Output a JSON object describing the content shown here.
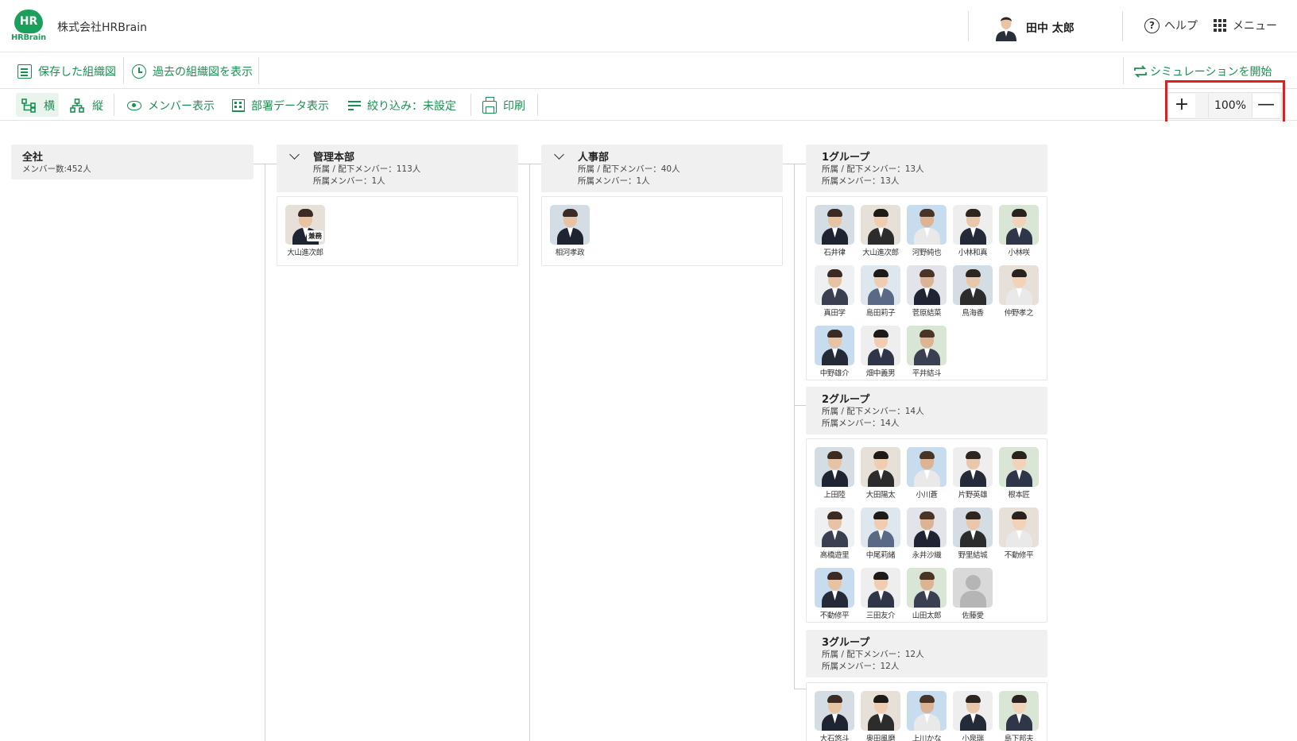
{
  "header": {
    "logo_mark": "HR",
    "logo_text": "HRBrain",
    "company": "株式会社HRBrain",
    "user_name": "田中 太郎",
    "help_label": "ヘルプ",
    "menu_label": "メニュー"
  },
  "toolbar1": {
    "saved_label": "保存した組織図",
    "past_label": "過去の組織図を表示",
    "simulation_label": "シミュレーションを開始"
  },
  "toolbar2": {
    "horizontal_label": "横",
    "vertical_label": "縦",
    "member_view_label": "メンバー表示",
    "dept_data_label": "部署データ表示",
    "filter_label": "絞り込み：未設定",
    "print_label": "印刷"
  },
  "zoom": {
    "value": "100%",
    "plus": "+",
    "minus": "—"
  },
  "org": {
    "company": {
      "name": "全社",
      "members": "メンバー数:452人"
    },
    "admin": {
      "name": "管理本部",
      "sub1": "所属 / 配下メンバー：113人",
      "sub2": "所属メンバー：1人",
      "members": [
        {
          "name": "大山進次郎",
          "badge": "兼務"
        }
      ]
    },
    "hr": {
      "name": "人事部",
      "sub1": "所属 / 配下メンバー：40人",
      "sub2": "所属メンバー：1人",
      "members": [
        {
          "name": "相河孝政"
        }
      ]
    },
    "groups": [
      {
        "name": "1グループ",
        "sub1": "所属 / 配下メンバー：13人",
        "sub2": "所属メンバー：13人",
        "members": [
          "石井律",
          "大山進次郎",
          "河野純也",
          "小林和真",
          "小林咲",
          "真田学",
          "島田莉子",
          "菅原結菜",
          "鳥海香",
          "仲野孝之",
          "中野雄介",
          "畑中義男",
          "平井結斗"
        ]
      },
      {
        "name": "2グループ",
        "sub1": "所属 / 配下メンバー：14人",
        "sub2": "所属メンバー：14人",
        "members": [
          "上田陸",
          "大田陽太",
          "小川蒼",
          "片野英雄",
          "根本匠",
          "高橋遊里",
          "中尾莉緒",
          "永井沙織",
          "野里結城",
          "不動修平",
          "不動修平",
          "三田友介",
          "山田太郎",
          "佐藤愛"
        ]
      },
      {
        "name": "3グループ",
        "sub1": "所属 / 配下メンバー：12人",
        "sub2": "所属メンバー：12人",
        "members": [
          "大石悠斗",
          "奥田風磨",
          "上川かな",
          "小泉瑞",
          "島下邦夫"
        ]
      }
    ]
  }
}
